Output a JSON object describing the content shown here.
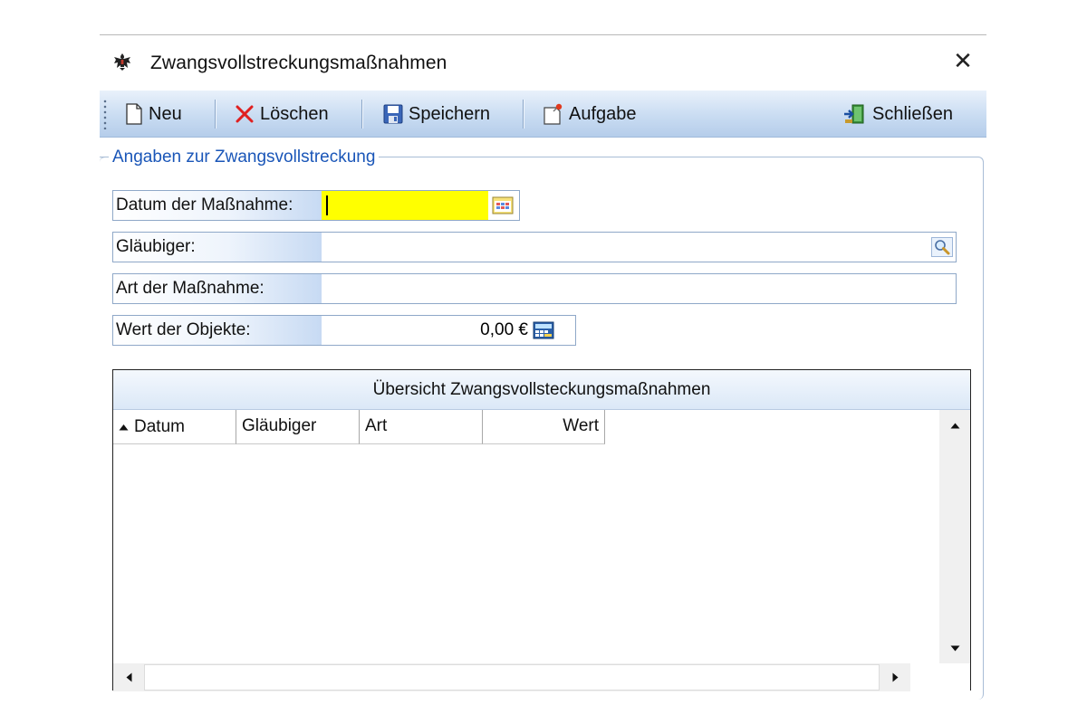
{
  "window": {
    "title": "Zwangsvollstreckungsmaßnahmen",
    "close_symbol": "✕"
  },
  "toolbar": {
    "new_label": "Neu",
    "delete_label": "Löschen",
    "save_label": "Speichern",
    "task_label": "Aufgabe",
    "close_label": "Schließen"
  },
  "group": {
    "legend": "Angaben zur Zwangsvollstreckung"
  },
  "form": {
    "date_label": "Datum der Maßnahme:",
    "date_value": "",
    "creditor_label": "Gläubiger:",
    "creditor_value": "",
    "type_label": "Art der Maßnahme:",
    "type_value": "",
    "value_label": "Wert der Objekte:",
    "value_amount": "0,00 €"
  },
  "grid": {
    "caption": "Übersicht Zwangsvollsteckungsmaßnahmen",
    "columns": [
      "Datum",
      "Gläubiger",
      "Art",
      "Wert"
    ],
    "sort_column": "Datum",
    "sort_direction": "ascending",
    "rows": []
  },
  "colors": {
    "toolbar_top": "#e9f1fb",
    "toolbar_bottom": "#b5cdea",
    "legend_text": "#1a56b8",
    "required_field": "#ffff00"
  }
}
